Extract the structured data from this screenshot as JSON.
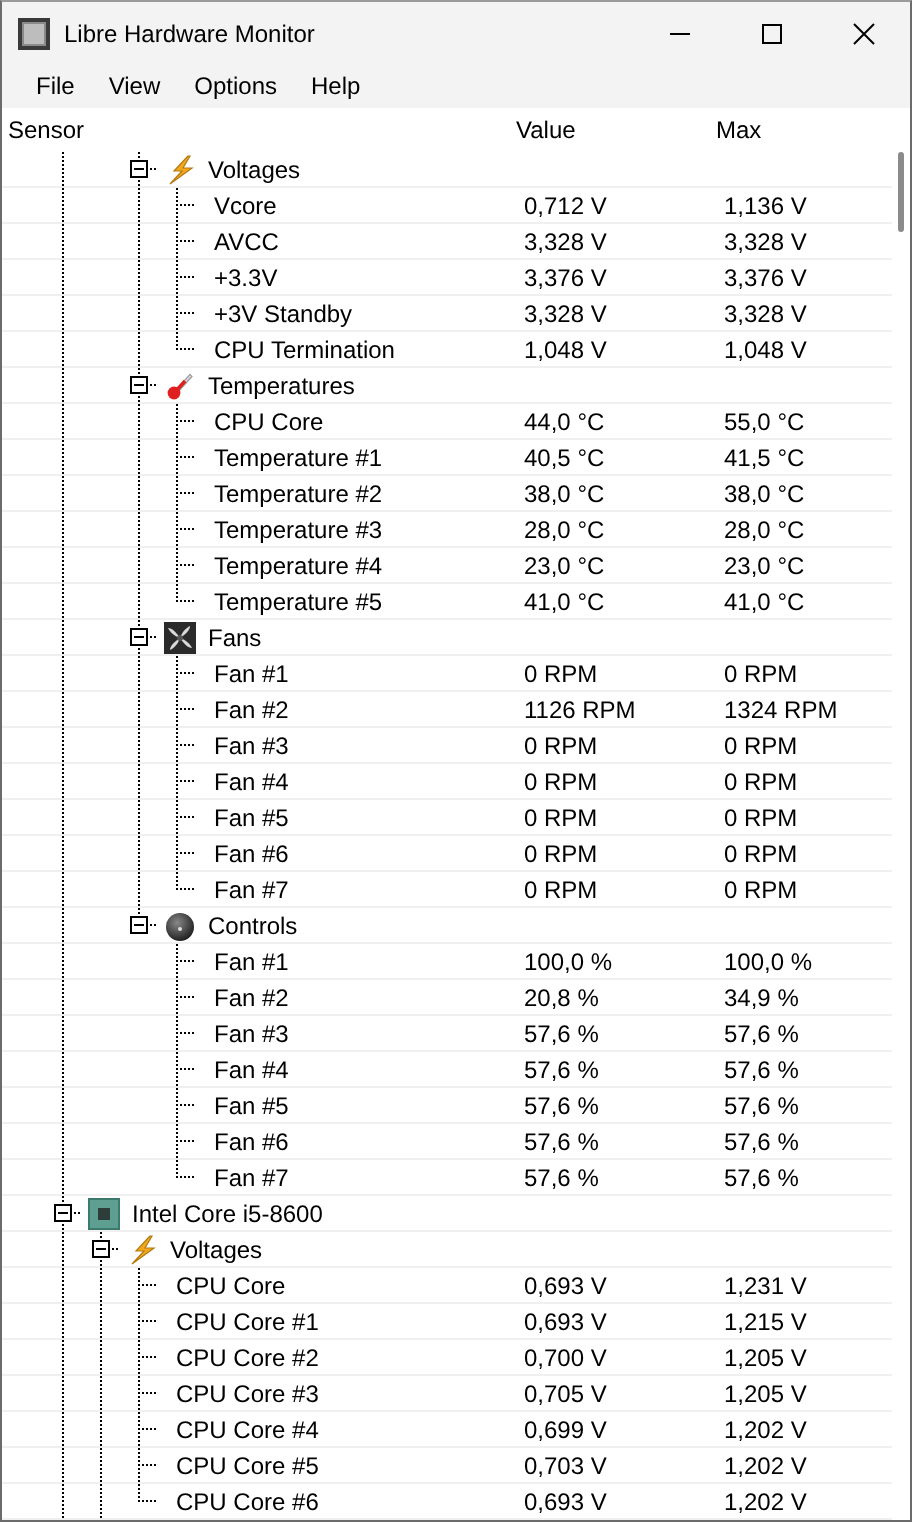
{
  "window": {
    "title": "Libre Hardware Monitor"
  },
  "menu": [
    "File",
    "View",
    "Options",
    "Help"
  ],
  "columns": [
    "Sensor",
    "Value",
    "Max"
  ],
  "tree": [
    {
      "children": [
        {
          "children": [
            {
              "name": "Voltages",
              "kind": "voltage",
              "expanded": true,
              "children": [
                {
                  "name": "Vcore",
                  "value": "0,712 V",
                  "max": "1,136 V"
                },
                {
                  "name": "AVCC",
                  "value": "3,328 V",
                  "max": "3,328 V"
                },
                {
                  "name": "+3.3V",
                  "value": "3,376 V",
                  "max": "3,376 V"
                },
                {
                  "name": "+3V Standby",
                  "value": "3,328 V",
                  "max": "3,328 V"
                },
                {
                  "name": "CPU Termination",
                  "value": "1,048 V",
                  "max": "1,048 V"
                }
              ]
            },
            {
              "name": "Temperatures",
              "kind": "temperature",
              "expanded": true,
              "children": [
                {
                  "name": "CPU Core",
                  "value": "44,0 °C",
                  "max": "55,0 °C"
                },
                {
                  "name": "Temperature #1",
                  "value": "40,5 °C",
                  "max": "41,5 °C"
                },
                {
                  "name": "Temperature #2",
                  "value": "38,0 °C",
                  "max": "38,0 °C"
                },
                {
                  "name": "Temperature #3",
                  "value": "28,0 °C",
                  "max": "28,0 °C"
                },
                {
                  "name": "Temperature #4",
                  "value": "23,0 °C",
                  "max": "23,0 °C"
                },
                {
                  "name": "Temperature #5",
                  "value": "41,0 °C",
                  "max": "41,0 °C"
                }
              ]
            },
            {
              "name": "Fans",
              "kind": "fan",
              "expanded": true,
              "children": [
                {
                  "name": "Fan #1",
                  "value": "0 RPM",
                  "max": "0 RPM"
                },
                {
                  "name": "Fan #2",
                  "value": "1126 RPM",
                  "max": "1324 RPM"
                },
                {
                  "name": "Fan #3",
                  "value": "0 RPM",
                  "max": "0 RPM"
                },
                {
                  "name": "Fan #4",
                  "value": "0 RPM",
                  "max": "0 RPM"
                },
                {
                  "name": "Fan #5",
                  "value": "0 RPM",
                  "max": "0 RPM"
                },
                {
                  "name": "Fan #6",
                  "value": "0 RPM",
                  "max": "0 RPM"
                },
                {
                  "name": "Fan #7",
                  "value": "0 RPM",
                  "max": "0 RPM"
                }
              ]
            },
            {
              "name": "Controls",
              "kind": "control",
              "expanded": true,
              "children": [
                {
                  "name": "Fan #1",
                  "value": "100,0 %",
                  "max": "100,0 %"
                },
                {
                  "name": "Fan #2",
                  "value": "20,8 %",
                  "max": "34,9 %"
                },
                {
                  "name": "Fan #3",
                  "value": "57,6 %",
                  "max": "57,6 %"
                },
                {
                  "name": "Fan #4",
                  "value": "57,6 %",
                  "max": "57,6 %"
                },
                {
                  "name": "Fan #5",
                  "value": "57,6 %",
                  "max": "57,6 %"
                },
                {
                  "name": "Fan #6",
                  "value": "57,6 %",
                  "max": "57,6 %"
                },
                {
                  "name": "Fan #7",
                  "value": "57,6 %",
                  "max": "57,6 %"
                }
              ]
            }
          ]
        }
      ]
    },
    {
      "name": "Intel Core i5-8600",
      "kind": "cpu",
      "expanded": true,
      "more_below": true,
      "children": [
        {
          "name": "Voltages",
          "kind": "voltage",
          "expanded": true,
          "more_below": true,
          "children": [
            {
              "name": "CPU Core",
              "value": "0,693 V",
              "max": "1,231 V"
            },
            {
              "name": "CPU Core #1",
              "value": "0,693 V",
              "max": "1,215 V"
            },
            {
              "name": "CPU Core #2",
              "value": "0,700 V",
              "max": "1,205 V"
            },
            {
              "name": "CPU Core #3",
              "value": "0,705 V",
              "max": "1,205 V"
            },
            {
              "name": "CPU Core #4",
              "value": "0,699 V",
              "max": "1,202 V"
            },
            {
              "name": "CPU Core #5",
              "value": "0,703 V",
              "max": "1,202 V"
            },
            {
              "name": "CPU Core #6",
              "value": "0,693 V",
              "max": "1,202 V"
            }
          ]
        }
      ]
    }
  ]
}
